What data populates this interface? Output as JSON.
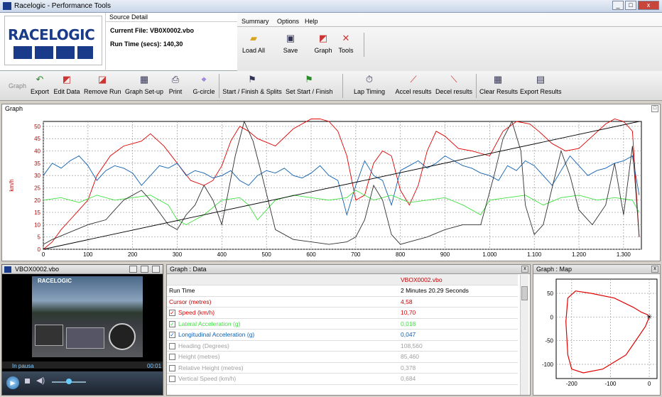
{
  "app": {
    "title": "Racelogic - Performance Tools"
  },
  "header": {
    "logo_text": "RACELOGIC",
    "source_heading": "Source Detail",
    "current_file": "Current File: VB0X0002.vbo",
    "run_time": "Run Time (secs): 140,30"
  },
  "menu": {
    "tabs": [
      "Summary",
      "Options",
      "Help"
    ],
    "buttons": [
      "Load All",
      "Save",
      "Graph",
      "Tools"
    ]
  },
  "ribbon": {
    "group_label": "Graph",
    "buttons": [
      "Export",
      "Edit Data",
      "Remove Run",
      "Graph Set-up",
      "Print",
      "G-circle",
      "Start / Finish & Splits",
      "Set Start / Finish",
      "Lap Timing",
      "Accel results",
      "Decel results",
      "Clear Results",
      "Export Results"
    ]
  },
  "graph": {
    "title": "Graph",
    "ylabel": "km/h"
  },
  "video": {
    "title": "VBOX0002.vbo",
    "logo": "RACELOGIC",
    "status": "In pausa",
    "time": "00:01"
  },
  "data_panel": {
    "title": "Graph : Data",
    "file": "VBOX0002.vbo",
    "rows": [
      {
        "label": "Run Time",
        "value": "2 Minutes 20.29 Seconds",
        "checkbox": "none",
        "color": "#000000"
      },
      {
        "label": "Cursor (metres)",
        "value": "4,58",
        "checkbox": "none",
        "color": "#c00000"
      },
      {
        "label": "Speed (km/h)",
        "value": "10,70",
        "checkbox": "checked",
        "color": "#e00000"
      },
      {
        "label": "Lateral Acceleration (g)",
        "value": "0,018",
        "checkbox": "checked",
        "color": "#40e040"
      },
      {
        "label": "Longitudinal Acceleration (g)",
        "value": "0,047",
        "checkbox": "checked",
        "color": "#1060b0"
      },
      {
        "label": "Heading (Degrees)",
        "value": "108,560",
        "checkbox": "unchecked",
        "color": "#a0a0a0"
      },
      {
        "label": "Height (metres)",
        "value": "85,460",
        "checkbox": "unchecked",
        "color": "#a0a0a0"
      },
      {
        "label": "Relative Height (metres)",
        "value": "0,378",
        "checkbox": "unchecked",
        "color": "#a0a0a0"
      },
      {
        "label": "Vertical Speed (km/h)",
        "value": "0,684",
        "checkbox": "unchecked",
        "color": "#a0a0a0"
      }
    ]
  },
  "map": {
    "title": "Graph : Map"
  },
  "chart_data": [
    {
      "type": "line",
      "ylabel": "km/h",
      "xlim": [
        0,
        1340
      ],
      "ylim": [
        0,
        52
      ],
      "x_ticks": [
        "0",
        "100",
        "200",
        "300",
        "400",
        "500",
        "600",
        "700",
        "800",
        "900",
        "1.000",
        "1.100",
        "1.200",
        "1.300"
      ],
      "y_ticks": [
        "0",
        "5",
        "10",
        "15",
        "20",
        "25",
        "30",
        "35",
        "40",
        "45",
        "50"
      ],
      "grid": true,
      "series": [
        {
          "color": "#e00000",
          "x": [
            0,
            20,
            40,
            60,
            80,
            100,
            120,
            150,
            180,
            200,
            220,
            240,
            270,
            300,
            330,
            360,
            380,
            400,
            420,
            440,
            460,
            480,
            520,
            560,
            600,
            620,
            640,
            660,
            680,
            700,
            720,
            740,
            760,
            780,
            800,
            820,
            840,
            860,
            880,
            900,
            930,
            960,
            1000,
            1030,
            1060,
            1090,
            1110,
            1140,
            1170,
            1200,
            1230,
            1260,
            1280,
            1300,
            1320,
            1335
          ],
          "y": [
            0,
            3,
            8,
            12,
            16,
            20,
            30,
            38,
            42,
            43,
            44,
            47,
            42,
            35,
            28,
            26,
            28,
            34,
            44,
            50,
            48,
            45,
            42,
            49,
            53,
            53,
            52,
            48,
            38,
            20,
            22,
            35,
            40,
            38,
            24,
            18,
            26,
            40,
            48,
            46,
            41,
            40,
            38,
            48,
            52,
            51,
            48,
            43,
            40,
            41,
            46,
            51,
            53,
            52,
            48,
            5
          ]
        },
        {
          "color": "#1060b0",
          "x": [
            0,
            20,
            40,
            60,
            80,
            100,
            120,
            140,
            160,
            180,
            200,
            220,
            240,
            260,
            280,
            300,
            320,
            340,
            360,
            380,
            400,
            420,
            440,
            460,
            480,
            500,
            520,
            540,
            560,
            580,
            600,
            620,
            640,
            660,
            680,
            700,
            720,
            740,
            760,
            780,
            800,
            820,
            840,
            860,
            880,
            900,
            920,
            940,
            960,
            980,
            1000,
            1020,
            1040,
            1060,
            1080,
            1100,
            1120,
            1140,
            1160,
            1180,
            1200,
            1220,
            1240,
            1260,
            1280,
            1300,
            1320,
            1335
          ],
          "y": [
            30,
            35,
            33,
            36,
            38,
            34,
            28,
            32,
            34,
            33,
            31,
            26,
            30,
            34,
            33,
            35,
            30,
            32,
            31,
            29,
            30,
            32,
            28,
            26,
            30,
            32,
            31,
            33,
            30,
            29,
            31,
            34,
            30,
            28,
            14,
            26,
            36,
            30,
            28,
            18,
            32,
            34,
            36,
            33,
            35,
            38,
            36,
            34,
            33,
            31,
            30,
            28,
            34,
            32,
            36,
            34,
            30,
            26,
            32,
            38,
            34,
            30,
            32,
            33,
            35,
            36,
            38,
            22
          ]
        },
        {
          "color": "#40e040",
          "x": [
            0,
            40,
            80,
            120,
            160,
            200,
            240,
            280,
            300,
            320,
            360,
            400,
            440,
            460,
            480,
            520,
            560,
            600,
            640,
            680,
            700,
            740,
            780,
            820,
            860,
            900,
            940,
            980,
            1000,
            1040,
            1080,
            1120,
            1160,
            1200,
            1240,
            1280,
            1320,
            1335
          ],
          "y": [
            20,
            21,
            19,
            22,
            20,
            21,
            22,
            18,
            12,
            10,
            14,
            20,
            21,
            18,
            12,
            20,
            22,
            21,
            20,
            21,
            24,
            20,
            22,
            19,
            20,
            21,
            18,
            14,
            20,
            21,
            22,
            18,
            21,
            22,
            20,
            21,
            20,
            15
          ]
        },
        {
          "color": "#303030",
          "x": [
            0,
            20,
            60,
            100,
            140,
            160,
            180,
            200,
            220,
            240,
            260,
            280,
            300,
            320,
            340,
            360,
            380,
            400,
            430,
            450,
            470,
            490,
            520,
            560,
            600,
            640,
            680,
            700,
            720,
            740,
            760,
            780,
            800,
            820,
            860,
            900,
            940,
            980,
            1010,
            1030,
            1050,
            1070,
            1080,
            1100,
            1120,
            1140,
            1160,
            1180,
            1200,
            1230,
            1260,
            1280,
            1300,
            1320,
            1335
          ],
          "y": [
            2,
            4,
            7,
            10,
            12,
            16,
            20,
            22,
            24,
            20,
            15,
            10,
            8,
            14,
            18,
            26,
            20,
            10,
            38,
            52,
            44,
            30,
            8,
            4,
            3,
            2,
            3,
            5,
            12,
            26,
            20,
            6,
            2,
            3,
            5,
            8,
            10,
            10,
            30,
            45,
            52,
            40,
            18,
            6,
            10,
            25,
            40,
            30,
            16,
            10,
            18,
            35,
            14,
            42,
            5
          ]
        },
        {
          "color": "#000000",
          "x": [
            0,
            1335
          ],
          "y": [
            0,
            52
          ]
        }
      ]
    },
    {
      "type": "line",
      "xlim": [
        -240,
        20
      ],
      "ylim": [
        -130,
        80
      ],
      "x_ticks": [
        "-200",
        "-100",
        "0"
      ],
      "y_ticks": [
        "50",
        "0",
        "-50",
        "-100"
      ],
      "grid": true,
      "series": [
        {
          "color": "#e00000",
          "x": [
            0,
            -10,
            -60,
            -120,
            -170,
            -200,
            -210,
            -215,
            -210,
            -190,
            -150,
            -90,
            -40,
            -20,
            -5,
            0
          ],
          "y": [
            0,
            -20,
            -80,
            -110,
            -118,
            -110,
            -80,
            -10,
            40,
            55,
            50,
            40,
            20,
            10,
            5,
            0
          ]
        }
      ]
    }
  ]
}
